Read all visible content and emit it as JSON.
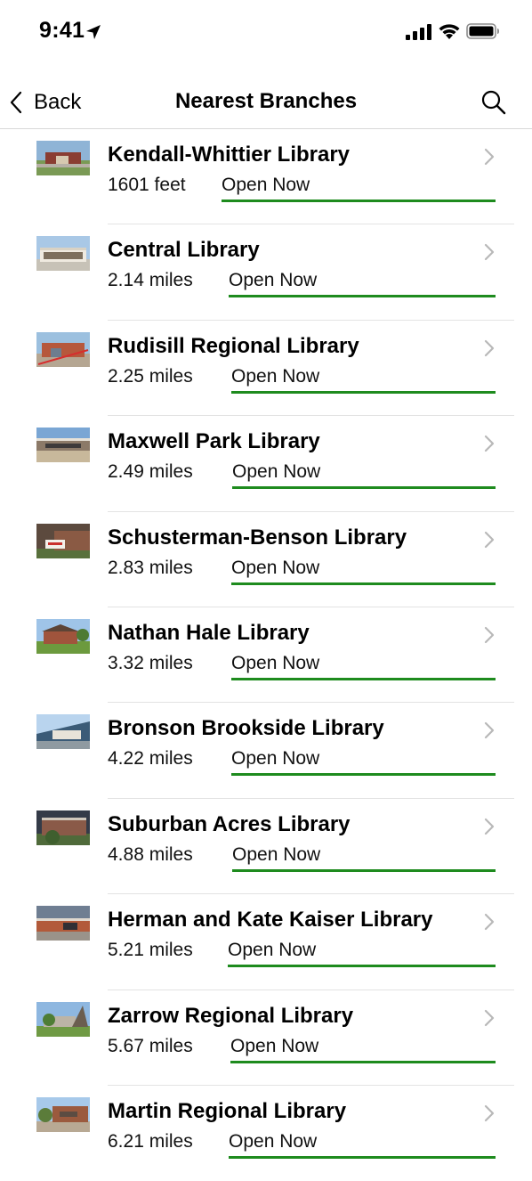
{
  "status_bar": {
    "time": "9:41"
  },
  "nav": {
    "back_label": "Back",
    "title": "Nearest Branches"
  },
  "colors": {
    "open_underline": "#1e8b1e",
    "chevron": "#b8b8b8"
  },
  "branches": [
    {
      "name": "Kendall-Whittier Library",
      "distance": "1601 feet",
      "status": "Open Now"
    },
    {
      "name": "Central Library",
      "distance": "2.14 miles",
      "status": "Open Now"
    },
    {
      "name": "Rudisill Regional Library",
      "distance": "2.25 miles",
      "status": "Open Now"
    },
    {
      "name": "Maxwell Park Library",
      "distance": "2.49 miles",
      "status": "Open Now"
    },
    {
      "name": "Schusterman-Benson Library",
      "distance": "2.83 miles",
      "status": "Open Now"
    },
    {
      "name": "Nathan Hale Library",
      "distance": "3.32 miles",
      "status": "Open Now"
    },
    {
      "name": "Bronson Brookside Library",
      "distance": "4.22 miles",
      "status": "Open Now"
    },
    {
      "name": "Suburban Acres Library",
      "distance": "4.88 miles",
      "status": "Open Now"
    },
    {
      "name": "Herman and Kate Kaiser Library",
      "distance": "5.21 miles",
      "status": "Open Now"
    },
    {
      "name": "Zarrow Regional Library",
      "distance": "5.67 miles",
      "status": "Open Now"
    },
    {
      "name": "Martin Regional Library",
      "distance": "6.21 miles",
      "status": "Open Now"
    }
  ]
}
